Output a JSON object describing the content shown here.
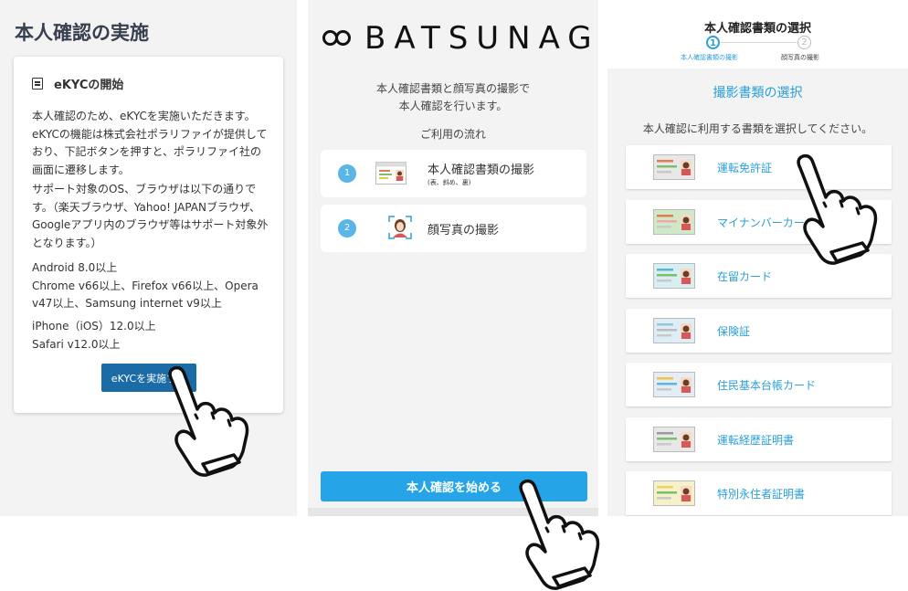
{
  "panel1": {
    "title": "本人確認の実施",
    "card_title": "eKYCの開始",
    "para1": "本人確認のため、eKYCを実施いただきます。eKYCの機能は株式会社ポラリファイが提供しており、下記ボタンを押すと、ポラリファイ社の画面に遷移します。",
    "para2": "サポート対象のOS、ブラウザは以下の通りです。（楽天ブラウザ、Yahoo! JAPANブラウザ、Googleアプリ内のブラウザ等はサポート対象外となります。）",
    "para3": "Android 8.0以上\nChrome v66以上、Firefox v66以上、Opera v47以上、Samsung internet v9以上",
    "para4": "iPhone（iOS）12.0以上\nSafari v12.0以上",
    "button_label": "eKYCを実施する"
  },
  "panel2": {
    "logo_text": "BATSUNAGU",
    "intro_line1": "本人確認書類と顔写真の撮影で",
    "intro_line2": "本人確認を行います。",
    "flow_title": "ご利用の流れ",
    "steps": [
      {
        "num": "1",
        "label": "本人確認書類の撮影",
        "sub": "(表、斜め、裏)"
      },
      {
        "num": "2",
        "label": "顔写真の撮影",
        "sub": ""
      }
    ],
    "start_button": "本人確認を始める"
  },
  "panel3": {
    "title": "本人確認書類の選択",
    "step1_num": "1",
    "step1_label": "本人確認書類の撮影",
    "step2_num": "2",
    "step2_label": "顔写真の撮影",
    "subheading": "撮影書類の選択",
    "instruction": "本人確認に利用する書類を選択してください。",
    "documents": [
      "運転免許証",
      "マイナンバーカード",
      "在留カード",
      "保険証",
      "住民基本台帳カード",
      "運転経歴証明書",
      "特別永住者証明書"
    ]
  },
  "colors": {
    "accent_blue": "#2a9fd8",
    "button_dark_blue": "#1a6ba6",
    "button_light_blue": "#25a5e8",
    "step_circle": "#5bb6e8"
  },
  "icons": {
    "hand": "pointing-hand-icon",
    "document": "document-icon",
    "id_card": "id-card-icon",
    "face": "face-portrait-icon"
  }
}
